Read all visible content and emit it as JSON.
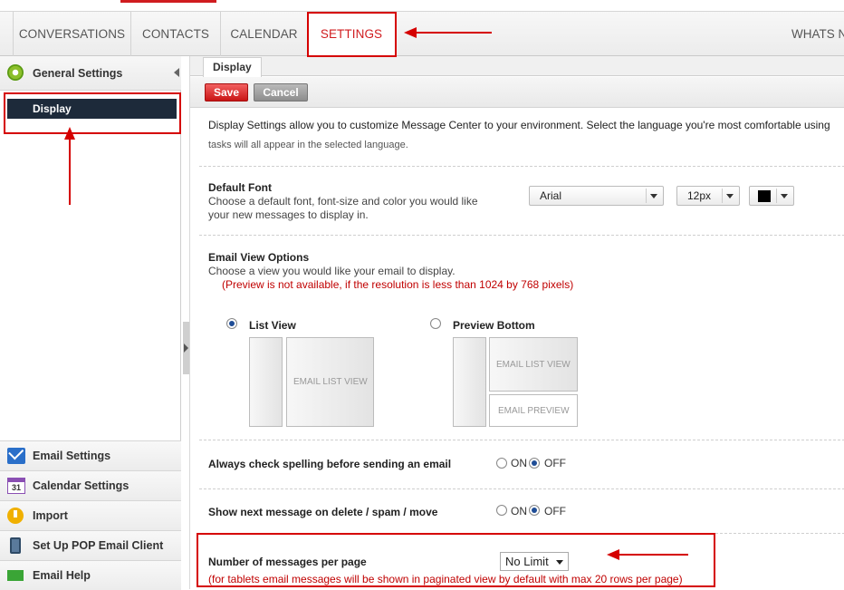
{
  "nav": {
    "tabs": [
      {
        "label": "CONVERSATIONS"
      },
      {
        "label": "CONTACTS"
      },
      {
        "label": "CALENDAR"
      },
      {
        "label": "SETTINGS",
        "active": true
      }
    ],
    "extra": "WHATS NE"
  },
  "sidebar": {
    "header": "General Settings",
    "selected": "Display",
    "items": [
      {
        "label": "Email Settings",
        "icon": "mail-icon"
      },
      {
        "label": "Calendar Settings",
        "icon": "calendar-icon",
        "icon_text": "31"
      },
      {
        "label": "Import",
        "icon": "import-icon"
      },
      {
        "label": "Set Up POP Email Client",
        "icon": "mobile-device-icon"
      },
      {
        "label": "Email Help",
        "icon": "help-arrow-icon"
      }
    ]
  },
  "main": {
    "tab": "Display",
    "toolbar": {
      "save": "Save",
      "cancel": "Cancel"
    },
    "description": "Display Settings allow you to customize Message Center to your environment. Select the language you're most comfortable using",
    "description_cont": "tasks will all appear in the selected language.",
    "default_font": {
      "title": "Default Font",
      "line1": "Choose a default font, font-size and color you would like",
      "line2": "your new messages to display in.",
      "font": "Arial",
      "size": "12px",
      "color": "#000000"
    },
    "email_view": {
      "title": "Email View Options",
      "subtitle": "Choose a view you would like your email to display.",
      "note": "(Preview is not available, if the resolution is less than 1024 by 768 pixels)",
      "list_view": "List View",
      "preview_bottom": "Preview Bottom",
      "list_pane_text": "EMAIL LIST VIEW",
      "preview_list_text": "EMAIL LIST VIEW",
      "preview_pane_text": "EMAIL PREVIEW",
      "selected": "List View"
    },
    "spelling": {
      "label": "Always check spelling before sending an email",
      "on": "ON",
      "off": "OFF",
      "value": "OFF"
    },
    "next_message": {
      "label": "Show next message on delete / spam / move",
      "on": "ON",
      "off": "OFF",
      "value": "OFF"
    },
    "per_page": {
      "label": "Number of messages per page",
      "value": "No Limit",
      "note": "(for tablets email messages will be shown in paginated view by default with max 20 rows per page)"
    }
  },
  "colors": {
    "accent": "#d01c1f",
    "annotation": "#d50000",
    "selected_bg": "#1d2a3a"
  }
}
